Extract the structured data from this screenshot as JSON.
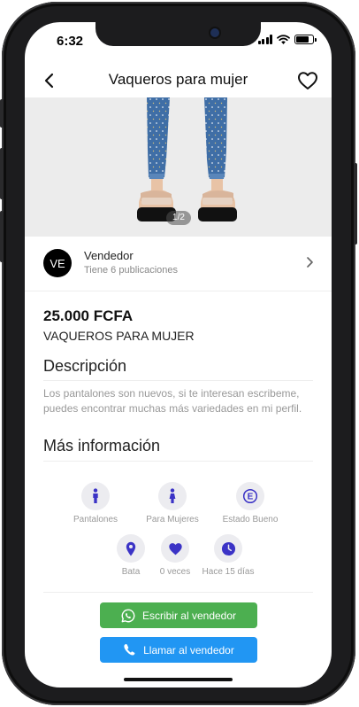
{
  "status_bar": {
    "time": "6:32",
    "battery_level": 0.8
  },
  "header": {
    "title": "Vaqueros para mujer",
    "back_icon": "chevron-left-icon",
    "favorite_icon": "heart-outline-icon"
  },
  "gallery": {
    "pager": "1/2"
  },
  "seller": {
    "initials": "VE",
    "name": "Vendedor",
    "subtitle": "Tiene 6 publicaciones"
  },
  "product": {
    "price": "25.000 FCFA",
    "title": "VAQUEROS PARA MUJER"
  },
  "description": {
    "heading": "Descripción",
    "text": "Los pantalones son nuevos, si te interesan escribeme, puedes encontrar muchas más variedades en mi perfil."
  },
  "more_info": {
    "heading": "Más información",
    "items": [
      {
        "icon": "person-icon",
        "label": "Pantalones"
      },
      {
        "icon": "woman-icon",
        "label": "Para Mujeres"
      },
      {
        "icon": "euro-circle-icon",
        "label": "Estado Bueno"
      },
      {
        "icon": "location-pin-icon",
        "label": "Bata"
      },
      {
        "icon": "heart-icon",
        "label": "0 veces"
      },
      {
        "icon": "clock-icon",
        "label": "Hace 15 días"
      }
    ]
  },
  "actions": {
    "whatsapp": "Escribir al vendedor",
    "call": "Llamar al vendedor"
  },
  "colors": {
    "icon_accent": "#3b33c6",
    "whatsapp": "#4caf50",
    "call": "#2196f3"
  }
}
